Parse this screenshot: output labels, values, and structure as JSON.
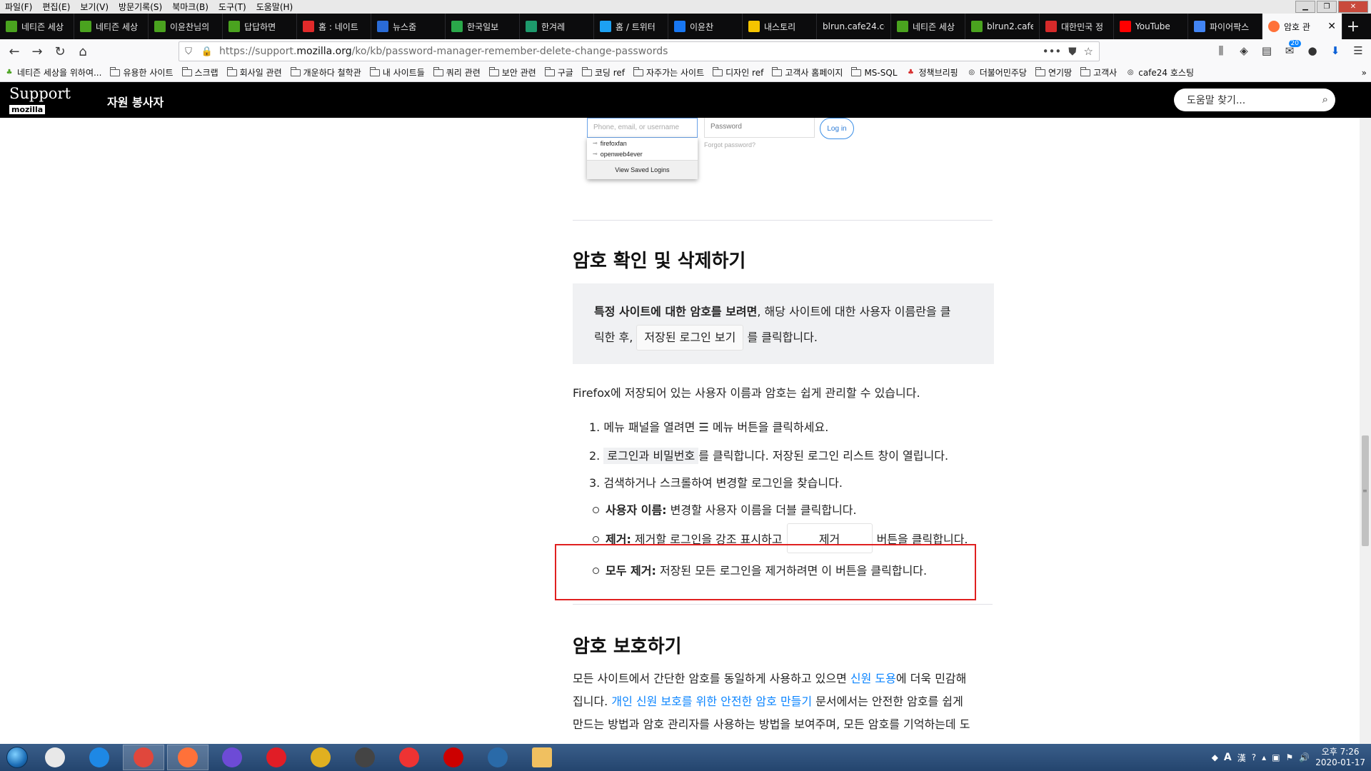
{
  "menu": [
    "파일(F)",
    "편집(E)",
    "보기(V)",
    "방문기록(S)",
    "북마크(B)",
    "도구(T)",
    "도움말(H)"
  ],
  "tabs": [
    {
      "label": "네티즌 세상",
      "icon": "netizen-icon",
      "color": "#4aa31f"
    },
    {
      "label": "네티즌 세상",
      "icon": "netizen-icon",
      "color": "#4aa31f"
    },
    {
      "label": "이윤찬님의",
      "icon": "netizen-icon",
      "color": "#4aa31f"
    },
    {
      "label": "답답하면",
      "icon": "netizen-icon",
      "color": "#4aa31f"
    },
    {
      "label": "홈 : 네이트",
      "icon": "nate-icon",
      "color": "#e02a2a"
    },
    {
      "label": "뉴스줌",
      "icon": "zoom-icon",
      "color": "#2a6bd6"
    },
    {
      "label": "한국일보",
      "icon": "pin-icon",
      "color": "#2aa84a"
    },
    {
      "label": "한겨레",
      "icon": "hani-icon",
      "color": "#1d9a6c"
    },
    {
      "label": "홈 / 트위터",
      "icon": "twitter-icon",
      "color": "#1da1f2"
    },
    {
      "label": "이윤찬",
      "icon": "facebook-icon",
      "color": "#1877f2"
    },
    {
      "label": "내스토리",
      "icon": "story-icon",
      "color": "#f5c400"
    },
    {
      "label": "blrun.cafe24.co",
      "icon": "",
      "color": ""
    },
    {
      "label": "네티즌 세상",
      "icon": "netizen-icon",
      "color": "#4aa31f"
    },
    {
      "label": "blrun2.cafe",
      "icon": "netizen-icon",
      "color": "#4aa31f"
    },
    {
      "label": "대한민국 정",
      "icon": "korea-icon",
      "color": "#d62a2a"
    },
    {
      "label": "YouTube",
      "icon": "youtube-icon",
      "color": "#ff0000"
    },
    {
      "label": "파이어팍스",
      "icon": "google-icon",
      "color": "#4285f4"
    }
  ],
  "active_tab": {
    "label": "암호 관",
    "icon": "firefox-icon",
    "color": "#ff7139"
  },
  "url": {
    "prefix": "https://support.",
    "domain": "mozilla.org",
    "path": "/ko/kb/password-manager-remember-delete-change-passwords"
  },
  "toolbar_badge": "20",
  "bookmarks": [
    {
      "label": "네티즌 세상을 위하여...",
      "type": "site"
    },
    {
      "label": "유용한 사이트",
      "type": "folder"
    },
    {
      "label": "스크랩",
      "type": "folder"
    },
    {
      "label": "회사일 관련",
      "type": "folder"
    },
    {
      "label": "개운하다 철학관",
      "type": "folder"
    },
    {
      "label": "내 사이트들",
      "type": "folder"
    },
    {
      "label": "쿼리 관련",
      "type": "folder"
    },
    {
      "label": "보안 관련",
      "type": "folder"
    },
    {
      "label": "구글",
      "type": "folder"
    },
    {
      "label": "코딩 ref",
      "type": "folder"
    },
    {
      "label": "자주가는 사이트",
      "type": "folder"
    },
    {
      "label": "디자인 ref",
      "type": "folder"
    },
    {
      "label": "고객사 홈페이지",
      "type": "folder"
    },
    {
      "label": "MS-SQL",
      "type": "folder"
    },
    {
      "label": "정책브리핑",
      "type": "site"
    },
    {
      "label": "더불어민주당",
      "type": "globe"
    },
    {
      "label": "연기땅",
      "type": "folder"
    },
    {
      "label": "고객사",
      "type": "folder"
    },
    {
      "label": "cafe24 호스팅",
      "type": "globe"
    }
  ],
  "site": {
    "logo_top": "Support",
    "logo_bottom": "mozilla",
    "volunteer": "자원 봉사자",
    "search_placeholder": "도움말 찾기..."
  },
  "login_mock": {
    "user_placeholder": "Phone, email, or username",
    "password": "Password",
    "forgot": "Forgot password?",
    "login_btn": "Log in",
    "saved": [
      "firefoxfan",
      "openweb4ever"
    ],
    "view_saved": "View Saved Logins"
  },
  "section1": {
    "title": "암호 확인 및 삭제하기",
    "callout_bold": "특정 사이트에 대한 암호를 보려면",
    "callout_rest": ", 해당 사이트에 대한 사용자 이름란을 클",
    "callout_line2a": "릭한 후, ",
    "callout_button": "저장된 로그인 보기",
    "callout_line2b": " 를 클릭합니다.",
    "intro": "Firefox에 저장되어 있는 사용자 이름과 암호는 쉽게 관리할 수 있습니다.",
    "steps": {
      "s1a": "메뉴 패널을 열려면 ",
      "s1icon": "☰",
      "s1b": " 메뉴 버튼을 클릭하세요.",
      "s2code": "로그인과 비밀번호",
      "s2b": "를 클릭합니다. 저장된 로그인 리스트 창이 열립니다.",
      "s3": "검색하거나 스크롤하여 변경할 로그인을 찾습니다."
    },
    "sub": {
      "user_b": "사용자 이름:",
      "user_t": " 변경할 사용자 이름을 더블 클릭합니다.",
      "remove_b": "제거:",
      "remove_t": " 제거할 로그인을 강조 표시하고",
      "remove_btn": "제거",
      "remove_t2": "버튼을 클릭합니다.",
      "all_b": "모두 제거:",
      "all_t": " 저장된 모든 로그인을 제거하려면 이 버튼을 클릭합니다."
    }
  },
  "section2": {
    "title": "암호 보호하기",
    "p1": "모든 사이트에서 간단한 암호를 동일하게 사용하고 있으면 ",
    "link1": "신원 도용",
    "p2": "에 더욱 민감해",
    "p3": "집니다. ",
    "link2": "개인 신원 보호를 위한 안전한 암호 만들기",
    "p4": " 문서에서는 안전한 암호를 쉽게",
    "p5": "만드는 방법과 암호 관리자를 사용하는 방법을 보여주며, 모든 암호를 기억하는데 도"
  },
  "taskbar": {
    "apps": [
      "vivaldi",
      "internet-explorer",
      "chrome",
      "firefox",
      "app-s",
      "opera",
      "app-arrow",
      "app-box",
      "app-ball",
      "app-red",
      "app-tree",
      "file-explorer"
    ],
    "time": "오후 7:26",
    "date": "2020-01-17",
    "ime": "A",
    "ime2": "漢"
  }
}
